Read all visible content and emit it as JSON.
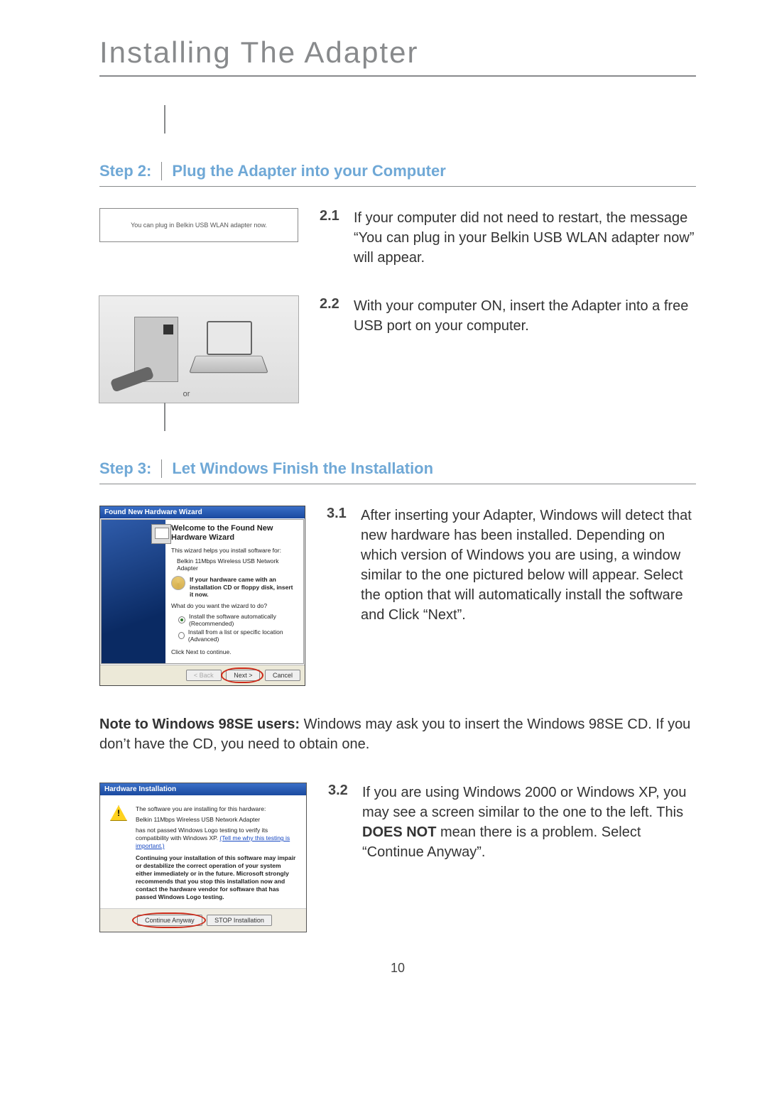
{
  "page_title": "Installing The Adapter",
  "page_number": "10",
  "step2": {
    "label": "Step 2:",
    "title": "Plug the Adapter into your Computer",
    "fig_msg": "You can plug in Belkin USB WLAN adapter now.",
    "or": "or",
    "items": [
      {
        "num": "2.1",
        "text": "If your computer did not need to restart, the message “You can plug in your Belkin USB WLAN adapter now” will appear."
      },
      {
        "num": "2.2",
        "text": "With your computer ON, insert the Adapter into a free USB port on your computer."
      }
    ]
  },
  "step3": {
    "label": "Step 3:",
    "title": "Let Windows Finish the Installation",
    "items": [
      {
        "num": "3.1",
        "text": "After inserting your Adapter, Windows will detect that new hardware has been installed. Depending on which version of Windows you are using, a window similar to the one pictured below will appear. Select the option that will automatically install the software and Click “Next”."
      },
      {
        "num": "3.2",
        "prefix": "If you are using Windows 2000 or Windows XP, you may see a screen similar to the one to the left. This ",
        "bold": "DOES NOT",
        "suffix": " mean there is a problem. Select “Continue Anyway”."
      }
    ],
    "wizard": {
      "titlebar": "Found New Hardware Wizard",
      "heading": "Welcome to the Found New Hardware Wizard",
      "line1": "This wizard helps you install software for:",
      "device": "Belkin 11Mbps Wireless USB Network Adapter",
      "cd_hint": "If your hardware came with an installation CD or floppy disk, insert it now.",
      "question": "What do you want the wizard to do?",
      "opt1": "Install the software automatically (Recommended)",
      "opt2": "Install from a list or specific location (Advanced)",
      "click_next": "Click Next to continue.",
      "btn_back": "< Back",
      "btn_next": "Next >",
      "btn_cancel": "Cancel"
    },
    "note_label": "Note to Windows 98SE users:",
    "note_text": " Windows may ask you to insert the Windows 98SE CD. If you don’t have the CD, you need to obtain one.",
    "hwinst": {
      "titlebar": "Hardware Installation",
      "line1": "The software you are installing for this hardware:",
      "device": "Belkin 11Mbps Wireless USB Network Adapter",
      "line2a": "has not passed Windows Logo testing to verify its compatibility with Windows XP. ",
      "link": "(Tell me why this testing is important.)",
      "warn": "Continuing your installation of this software may impair or destabilize the correct operation of your system either immediately or in the future. Microsoft strongly recommends that you stop this installation now and contact the hardware vendor for software that has passed Windows Logo testing.",
      "btn_continue": "Continue Anyway",
      "btn_stop": "STOP Installation"
    }
  }
}
